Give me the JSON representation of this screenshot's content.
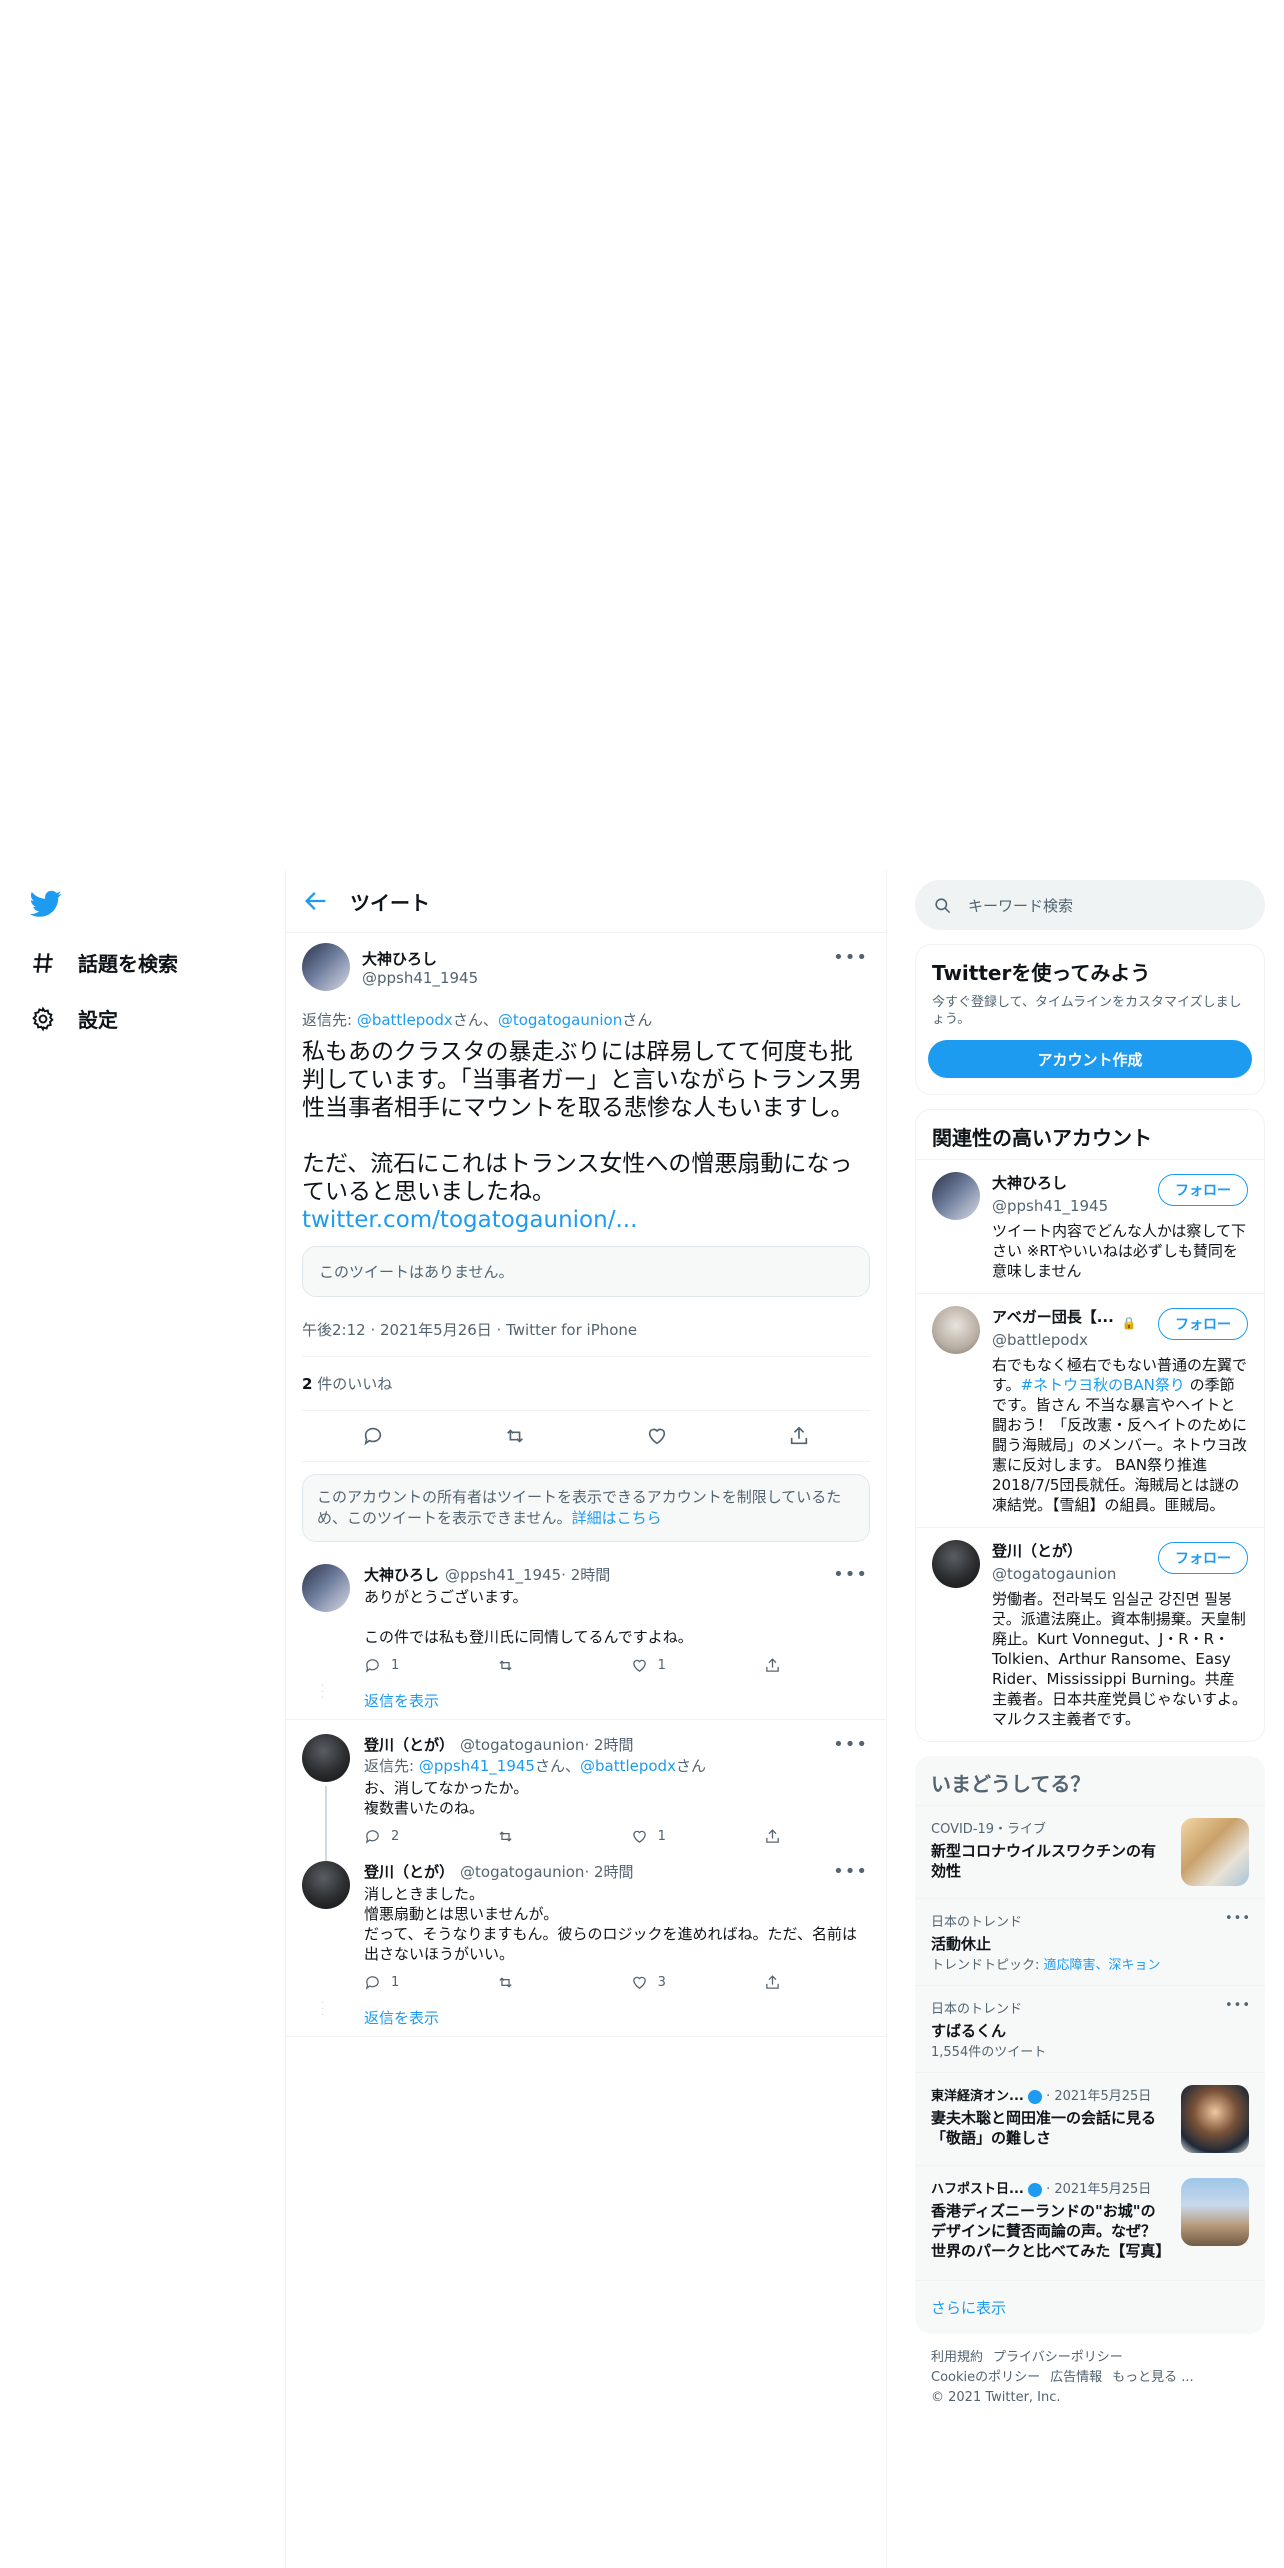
{
  "nav": {
    "explore_label": "話題を検索",
    "settings_label": "設定"
  },
  "header": {
    "title": "ツイート"
  },
  "main_tweet": {
    "name": "大神ひろし",
    "handle": "@ppsh41_1945",
    "reply_prefix": "返信先: ",
    "reply_user1": "@battlepodx",
    "reply_sep1": "さん、",
    "reply_user2": "@togatogaunion",
    "reply_sep2": "さん",
    "text": "私もあのクラスタの暴走ぶりには辟易してて何度も批判しています。「当事者ガー」と言いながらトランス男性当事者相手にマウントを取る悲惨な人もいますし。\n\nただ、流石にこれはトランス女性への憎悪扇動になっていると思いましたね。",
    "link": "twitter.com/togatogaunion/...",
    "unavailable": "このツイートはありません。",
    "meta": "午後2:12 · 2021年5月26日 · Twitter for iPhone",
    "likes_count": "2",
    "likes_label": " 件のいいね"
  },
  "restrict_notice": {
    "text": "このアカウントの所有者はツイートを表示できるアカウントを制限しているため、このツイートを表示できません。",
    "link": "詳細はこちら"
  },
  "replies": [
    {
      "name": "大神ひろし",
      "handle": "@ppsh41_1945",
      "time": " · 2時間",
      "text": "ありがとうございます。\n\nこの件では私も登川氏に同情してるんですよね。",
      "reply_count": "1",
      "like_count": "1"
    },
    {
      "name": "登川（とが）",
      "handle": "@togatogaunion",
      "time": " · 2時間",
      "reply_prefix": "返信先: ",
      "reply_user1": "@ppsh41_1945",
      "reply_sep1": "さん、",
      "reply_user2": "@battlepodx",
      "reply_sep2": "さん",
      "text": "お、消してなかったか。\n複数書いたのね。",
      "reply_count": "2",
      "like_count": "1"
    },
    {
      "name": "登川（とが）",
      "handle": "@togatogaunion",
      "time": " · 2時間",
      "text": "消しときました。\n憎悪扇動とは思いませんが。\nだって、そうなりますもん。彼らのロジックを進めればね。ただ、名前は出さないほうがいい。",
      "reply_count": "1",
      "like_count": "3"
    }
  ],
  "show_replies_label": "返信を表示",
  "right": {
    "search_placeholder": "キーワード検索",
    "signup": {
      "title": "Twitterを使ってみよう",
      "sub": "今すぐ登録して、タイムラインをカスタマイズしましょう。",
      "button": "アカウント作成"
    },
    "relevant": {
      "title": "関連性の高いアカウント",
      "follow_label": "フォロー",
      "accounts": [
        {
          "name": "大神ひろし",
          "handle": "@ppsh41_1945",
          "bio": "ツイート内容でどんな人かは察して下さい ※RTやいいねは必ずしも賛同を意味しません"
        },
        {
          "name": "アベガー団長【...",
          "handle": "@battlepodx",
          "bio_pre": "右でもなく極右でもない普通の左翼です。",
          "bio_tag": "#ネトウヨ秋のBAN祭り",
          "bio_post": " の季節です。皆さん 不当な暴言やヘイトと闘おう！「反改憲・反ヘイトのために闘う海賊局」のメンバー。ネトウヨ改憲に反対します。 BAN祭り推進 2018/7/5団長就任。海賊局とは謎の凍結党。【雪組】の組員。匪賊局。"
        },
        {
          "name": "登川（とが）",
          "handle": "@togatogaunion",
          "bio": "労働者。전라북도 임실군 강진면 필봉굿。派遣法廃止。資本制揚棄。天皇制廃止。Kurt Vonnegut、J・R・R・Tolkien、Arthur Ransome、Easy Rider、Mississippi Burning。共産主義者。日本共産党員じゃないすよ。マルクス主義者です。"
        }
      ]
    },
    "trends": {
      "title": "いまどうしてる？",
      "items": [
        {
          "context": "COVID-19・ライブ",
          "title": "新型コロナウイルスワクチンの有効性"
        },
        {
          "context": "日本のトレンド",
          "title": "活動休止",
          "topic_label": "トレンドトピック: ",
          "topic_value": "適応障害、深キョン"
        },
        {
          "context": "日本のトレンド",
          "title": "すばるくん",
          "count": "1,554件のツイート"
        },
        {
          "source": "東洋経済オン...",
          "date": " · 2021年5月25日",
          "title": "妻夫木聡と岡田准一の会話に見る「敬語」の難しさ"
        },
        {
          "source": "ハフポスト日...",
          "date": " · 2021年5月25日",
          "title": "香港ディズニーランドの\"お城\"のデザインに賛否両論の声。なぜ？世界のパークと比べてみた【写真】"
        }
      ],
      "show_more": "さらに表示"
    },
    "footer": {
      "terms": "利用規約",
      "privacy": "プライバシーポリシー",
      "cookie": "Cookieのポリシー",
      "ads": "広告情報",
      "more": "もっと見る ...",
      "copyright": "© 2021 Twitter, Inc."
    }
  },
  "colors": {
    "accent": "#1d9bf0",
    "text": "#0f1419",
    "muted": "#536471"
  }
}
